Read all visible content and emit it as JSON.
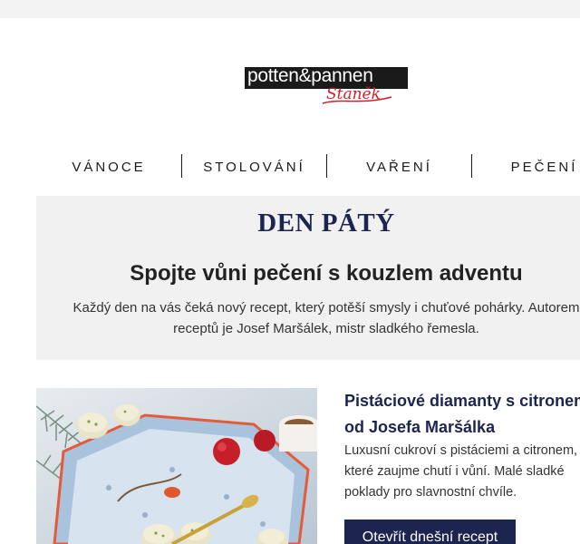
{
  "brand": {
    "logo_text": "potten&pannen",
    "logo_script": "Staněk"
  },
  "nav": {
    "items": [
      {
        "label": "VÁNOCE"
      },
      {
        "label": "STOLOVÁNÍ"
      },
      {
        "label": "VAŘENÍ"
      },
      {
        "label": "PEČENÍ"
      }
    ]
  },
  "intro": {
    "day": "DEN PÁTÝ",
    "title": "Spojte vůni pečení s kouzlem adventu",
    "text_line1": "Každý den na vás čeká nový recept, který potěší smysly i chuťové pohárky. Autorem",
    "text_line2": "receptů je Josef Maršálek, mistr sladkého řemesla."
  },
  "recipe": {
    "title_line1": "Pistáciové diamanty s citronem",
    "title_line2": "od Josefa Maršálka",
    "desc_line1": "Luxusní cukroví s pistáciemi a citronem,",
    "desc_line2": "které zaujme chutí i vůní. Malé sladké",
    "desc_line3": "poklady pro slavnostní chvíle.",
    "button_label": "Otevřít dnešní recept"
  },
  "colors": {
    "navy": "#1c2450",
    "brand_red": "#d21f2a",
    "panel_bg": "#f1f1f1"
  }
}
